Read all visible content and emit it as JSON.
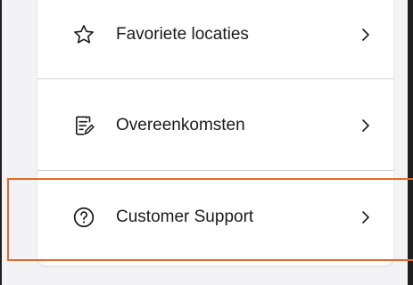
{
  "menu": {
    "items": [
      {
        "label": "Favoriete locaties",
        "icon": "star-outline-icon"
      },
      {
        "label": "Overeenkomsten",
        "icon": "document-edit-icon"
      },
      {
        "label": "Customer Support",
        "icon": "question-circle-icon"
      }
    ],
    "chevron": ">"
  },
  "colors": {
    "highlight": "#e8692b",
    "screen_background": "#f3f3f5",
    "card_background": "#ffffff",
    "divider": "#cfcfd4",
    "text": "#1a1a1a"
  }
}
